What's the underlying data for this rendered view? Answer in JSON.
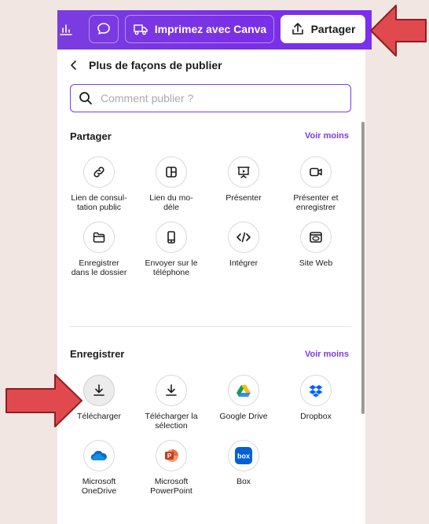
{
  "toolbar": {
    "print_label": "Imprimez avec Canva",
    "share_label": "Partager"
  },
  "panel": {
    "header": "Plus de façons de publier",
    "search_placeholder": "Comment publier ?"
  },
  "share_section": {
    "title": "Partager",
    "toggle": "Voir moins",
    "items": [
      {
        "label": "Lien de consul-\ntation public",
        "icon": "link-icon"
      },
      {
        "label": "Lien du mo-\ndèle",
        "icon": "template-icon"
      },
      {
        "label": "Présenter",
        "icon": "present-icon"
      },
      {
        "label": "Présenter et\nenregistrer",
        "icon": "record-icon"
      },
      {
        "label": "Enregistrer\ndans le dossier",
        "icon": "folder-icon"
      },
      {
        "label": "Envoyer sur le\ntéléphone",
        "icon": "phone-icon"
      },
      {
        "label": "Intégrer",
        "icon": "embed-icon"
      },
      {
        "label": "Site Web",
        "icon": "website-icon"
      }
    ]
  },
  "save_section": {
    "title": "Enregistrer",
    "toggle": "Voir moins",
    "items": [
      {
        "label": "Télécharger",
        "icon": "download-icon"
      },
      {
        "label": "Télécharger la\nsélection",
        "icon": "download-selection-icon"
      },
      {
        "label": "Google Drive",
        "icon": "google-drive-icon"
      },
      {
        "label": "Dropbox",
        "icon": "dropbox-icon"
      },
      {
        "label": "Microsoft\nOneDrive",
        "icon": "onedrive-icon"
      },
      {
        "label": "Microsoft\nPowerPoint",
        "icon": "powerpoint-icon"
      },
      {
        "label": "Box",
        "icon": "box-icon"
      }
    ]
  },
  "colors": {
    "accent": "#7c3aed",
    "toolbar": "#7b2ff0",
    "arrow": "#e04a4f",
    "background": "#f1e6e1"
  }
}
